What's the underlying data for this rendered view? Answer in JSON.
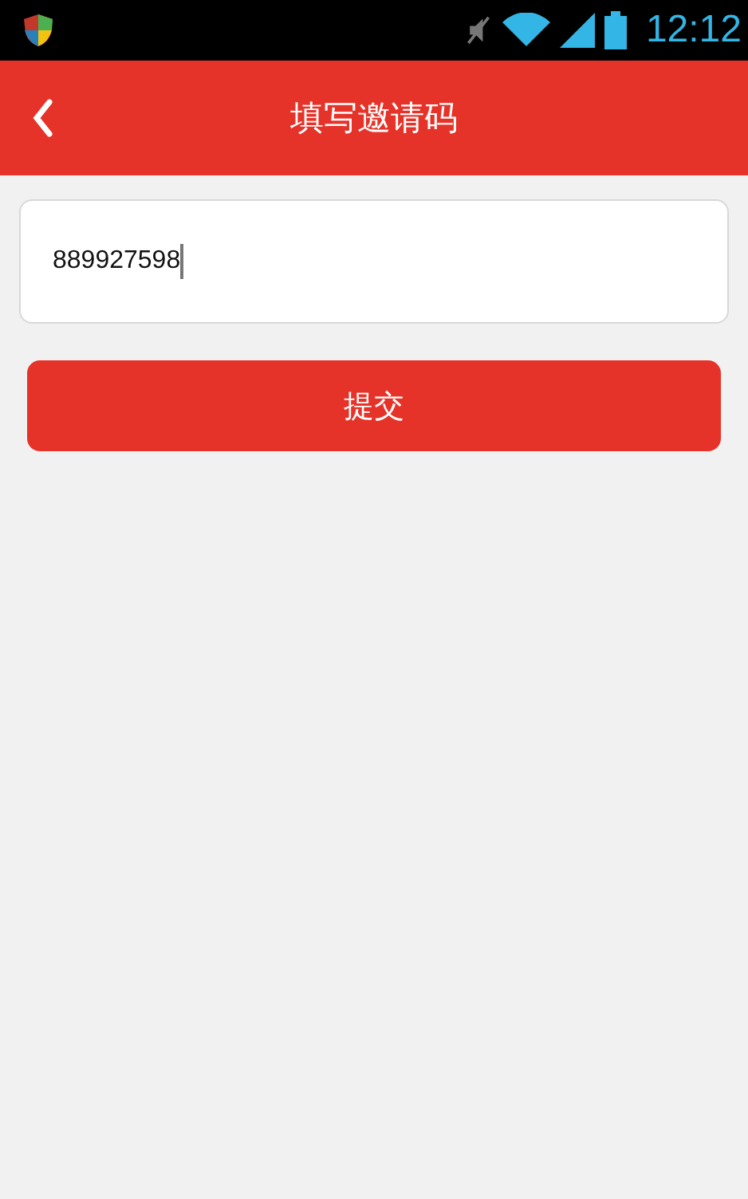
{
  "status_bar": {
    "time": "12:12"
  },
  "header": {
    "title": "填写邀请码"
  },
  "invite_field": {
    "value": "889927598"
  },
  "submit_button": {
    "label": "提交"
  }
}
